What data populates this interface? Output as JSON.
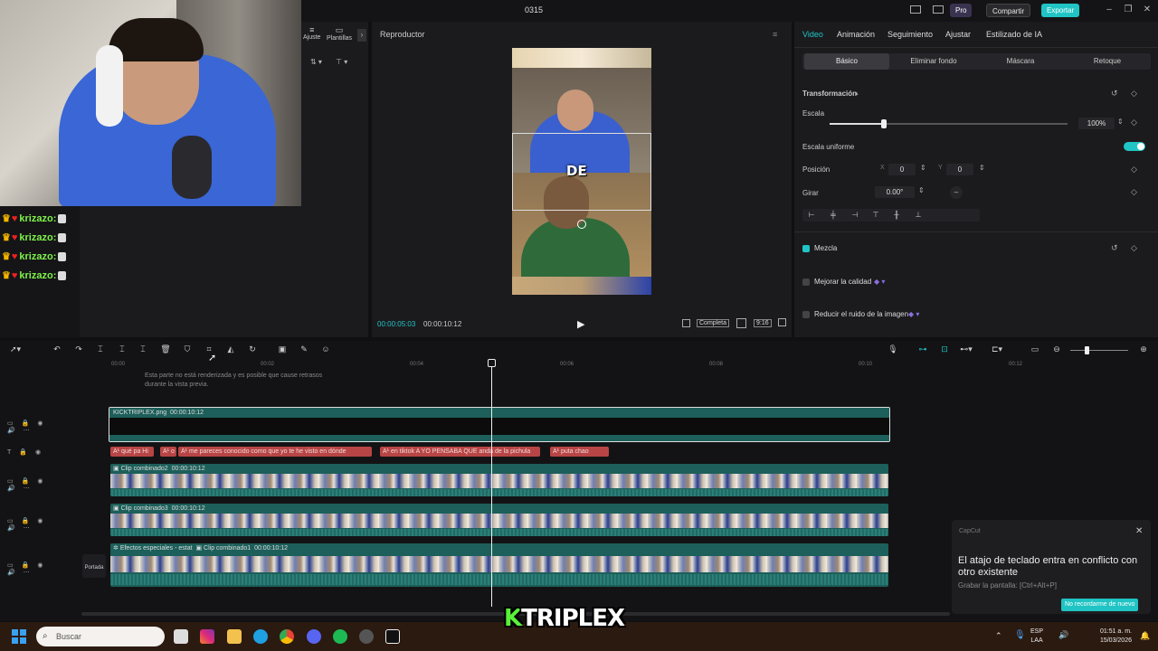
{
  "window": {
    "project_name": "0315"
  },
  "topbar": {
    "pro_label": "Pro",
    "share_label": "Compartir",
    "export_label": "Exportar"
  },
  "media_panel": {
    "tab1": "Ajuste",
    "tab2": "Plantillas"
  },
  "chat": {
    "lines": [
      {
        "user": "krizazo:"
      },
      {
        "user": "krizazo:"
      },
      {
        "user": "krizazo:"
      },
      {
        "user": "krizazo:"
      }
    ]
  },
  "player": {
    "title": "Reproductor",
    "caption_word": "DE",
    "time_current": "00:00:05:03",
    "time_total": "00:00:10:12",
    "completa_label": "Completa",
    "ratio_label": "9:16"
  },
  "properties": {
    "tabs": [
      "Video",
      "Animación",
      "Seguimiento",
      "Ajustar",
      "Estilizado de IA"
    ],
    "subtabs": [
      "Básico",
      "Eliminar fondo",
      "Máscara",
      "Retoque"
    ],
    "transform_label": "Transformación",
    "scale_label": "Escala",
    "scale_value": "100%",
    "scale_fraction": 0.23,
    "uniform_label": "Escala uniforme",
    "position_label": "Posición",
    "pos_x_label": "X",
    "pos_x": "0",
    "pos_y_label": "Y",
    "pos_y": "0",
    "rotate_label": "Girar",
    "rotate_value": "0.00°",
    "blend_label": "Mezcla",
    "quality_label": "Mejorar la calidad",
    "noise_label": "Reducir el ruido de la imagen"
  },
  "timeline": {
    "ticks": [
      "00:00",
      "00:02",
      "00:04",
      "00:06",
      "00:08",
      "00:10",
      "00:12"
    ],
    "tooltip": "Esta parte no está renderizada y es posible que cause retrasos durante la vista previa.",
    "main_clip_label": "KICKTRIPLEX.png",
    "main_clip_duration": "00:00:10:12",
    "text_clips": [
      "A¹ qué pa Hi",
      "A¹ o",
      "A¹ me pareces conocido como que yo te he visto en dónde",
      "A¹ en tiktok A YO PENSABA QUE anda de la pichula",
      "A¹ puta chao"
    ],
    "video_clips": [
      {
        "label": "Clip combinado2",
        "duration": "00:00:10:12"
      },
      {
        "label": "Clip combinado3",
        "duration": "00:00:10:12"
      },
      {
        "label": "Efectos especiales - estat",
        "label2": "Clip combinado1",
        "duration": "00:00:10:12"
      }
    ],
    "cover_label": "Portada"
  },
  "toast": {
    "app": "CapCut",
    "title": "El atajo de teclado entra en conflicto con otro existente",
    "subtitle": "Grabar la pantalla: [Ctrl+Alt+P]",
    "button": "No recordarme de nuevo"
  },
  "taskbar": {
    "search_placeholder": "Buscar",
    "lang1": "ESP",
    "lang2": "LAA",
    "time": "01:51 a. m.",
    "date": "15/03/2026"
  },
  "logo": {
    "k": "K",
    "rest": "TRIPLEX"
  },
  "colors": {
    "accent": "#21c4c4",
    "text_clip": "#b84545",
    "video_clip": "#1d5f5a"
  }
}
